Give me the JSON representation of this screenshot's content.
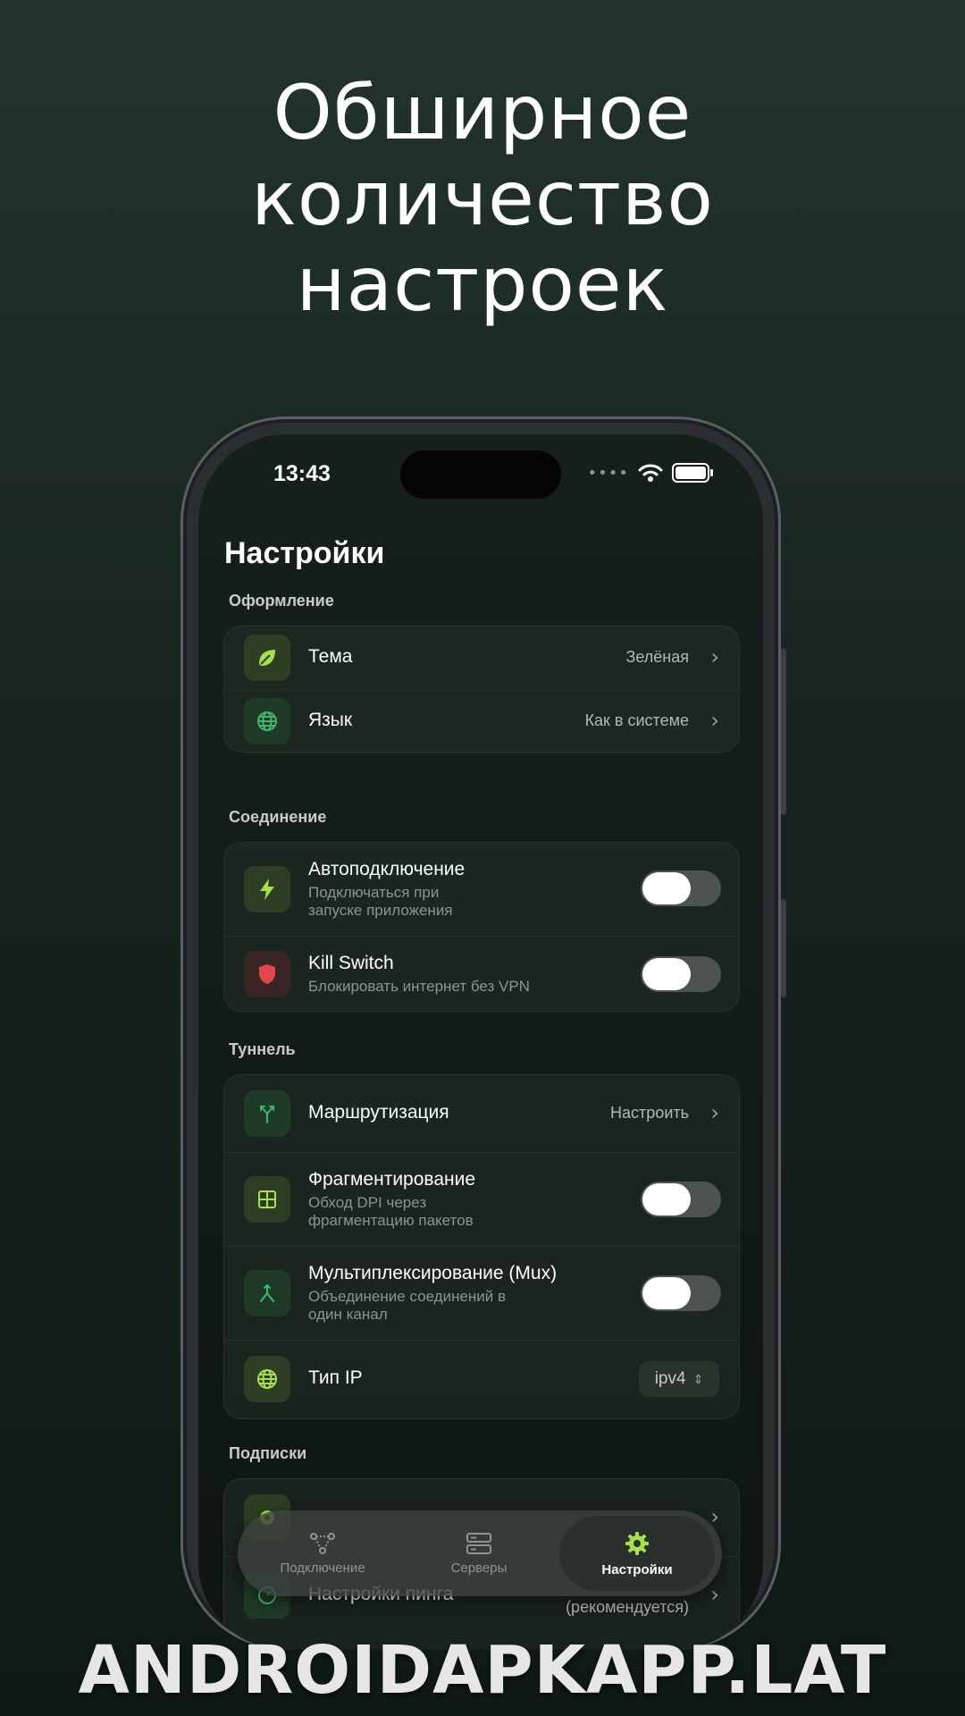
{
  "headline": [
    "Обширное",
    "количество",
    "настроек"
  ],
  "status": {
    "time": "13:43",
    "dots": "••••"
  },
  "page_title": "Настройки",
  "sections": {
    "appearance": {
      "label": "Оформление",
      "theme": {
        "title": "Тема",
        "value": "Зелёная",
        "icon": "leaf-icon"
      },
      "language": {
        "title": "Язык",
        "value": "Как в системе",
        "icon": "globe-icon"
      }
    },
    "connection": {
      "label": "Соединение",
      "autoconnect": {
        "title": "Автоподключение",
        "subtitle_1": "Подключаться при",
        "subtitle_2": "запуске приложения",
        "enabled": false,
        "icon": "bolt-icon"
      },
      "killswitch": {
        "title": "Kill Switch",
        "subtitle": "Блокировать интернет без VPN",
        "enabled": false,
        "icon": "shield-icon"
      }
    },
    "tunnel": {
      "label": "Туннель",
      "routing": {
        "title": "Маршрутизация",
        "value": "Настроить",
        "icon": "route-split-icon"
      },
      "fragmentation": {
        "title": "Фрагментирование",
        "subtitle_1": "Обход DPI через",
        "subtitle_2": "фрагментацию пакетов",
        "enabled": false,
        "icon": "grid-icon"
      },
      "mux": {
        "title": "Мультиплексирование (Mux)",
        "subtitle_1": "Объединение соединений в",
        "subtitle_2": "один канал",
        "enabled": false,
        "icon": "merge-icon"
      },
      "ip_type": {
        "title": "Тип IP",
        "value": "ipv4",
        "icon": "globe-icon"
      }
    },
    "subscriptions": {
      "label": "Подписки",
      "ping_settings": {
        "title": "Настройки пинга",
        "value": "(рекомендуется)"
      }
    }
  },
  "tabbar": {
    "connection": "Подключение",
    "servers": "Серверы",
    "settings": "Настройки",
    "active": "settings"
  },
  "watermark": "ANDROIDAPKAPP.LAT",
  "colors": {
    "accent": "#a6e04a",
    "icon_green": "#3fb86a",
    "icon_red": "#e0474f"
  }
}
